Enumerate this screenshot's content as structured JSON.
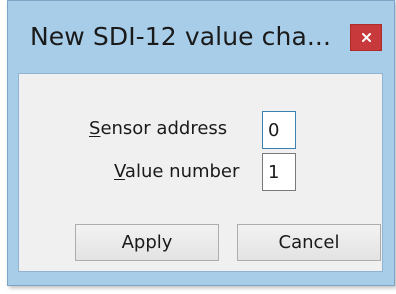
{
  "window": {
    "title": "New SDI-12 value cha..."
  },
  "form": {
    "sensor_address": {
      "label_accel": "S",
      "label_rest": "ensor address",
      "value": "0"
    },
    "value_number": {
      "label_accel": "V",
      "label_rest": "alue number",
      "value": "1"
    }
  },
  "buttons": {
    "apply_label": "Apply",
    "cancel_label": "Cancel"
  },
  "icons": {
    "close": "close-icon"
  },
  "colors": {
    "frame": "#a8cde8",
    "close_button": "#c7393a",
    "client_bg": "#f0f0f0"
  }
}
